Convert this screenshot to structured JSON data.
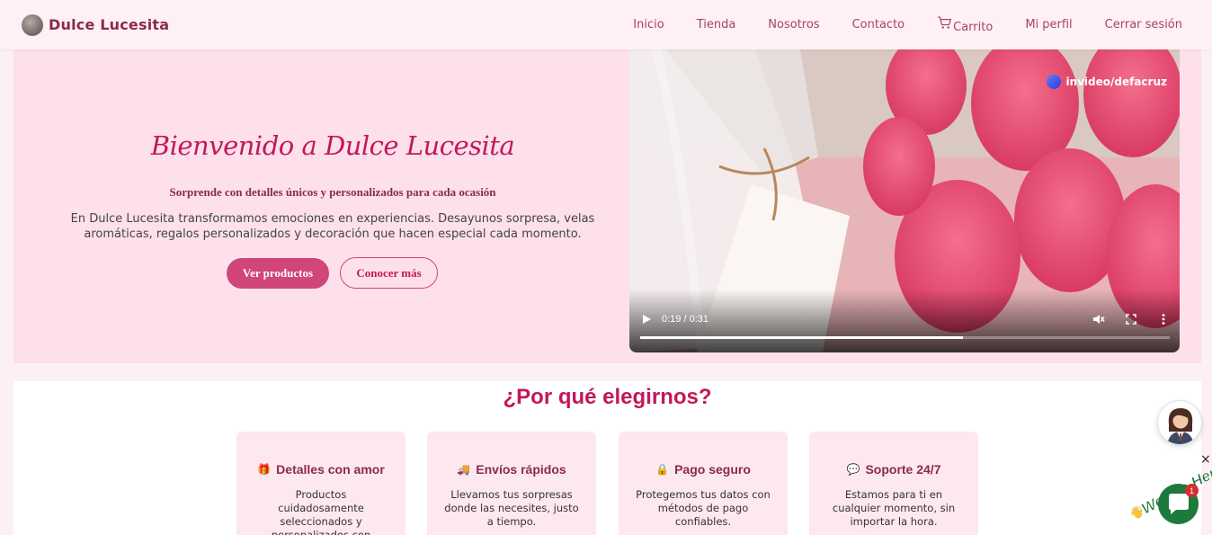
{
  "nav": {
    "brand": "Dulce Lucesita",
    "links": [
      "Inicio",
      "Tienda",
      "Nosotros",
      "Contacto",
      "Carrito",
      "Mi perfil",
      "Cerrar sesión"
    ]
  },
  "hero": {
    "title": "Bienvenido a Dulce Lucesita",
    "subtitle": "Sorprende con detalles únicos y personalizados para cada ocasión",
    "description": "En Dulce Lucesita transformamos emociones en experiencias. Desayunos sorpresa, velas aromáticas, regalos personalizados y decoración que hacen especial cada momento.",
    "btn_primary": "Ver productos",
    "btn_secondary": "Conocer más"
  },
  "video": {
    "watermark": "invideo/defacruz",
    "time": "0:19 / 0:31",
    "progress": 0.61
  },
  "why": {
    "title": "¿Por qué elegirnos?",
    "cards": [
      {
        "emoji": "🎁",
        "title": "Detalles con amor",
        "text": "Productos cuidadosamente seleccionados y personalizados con elegancia."
      },
      {
        "emoji": "🚚",
        "title": "Envíos rápidos",
        "text": "Llevamos tus sorpresas donde las necesites, justo a tiempo."
      },
      {
        "emoji": "🔒",
        "title": "Pago seguro",
        "text": "Protegemos tus datos con métodos de pago confiables."
      },
      {
        "emoji": "💬",
        "title": "Soporte 24/7",
        "text": "Estamos para ti en cualquier momento, sin importar la hora."
      }
    ]
  },
  "chat": {
    "tag": "We Are Here!",
    "badge": "1",
    "close": "×"
  },
  "colors": {
    "brand": "#8a2a4f",
    "accent": "#d0457a",
    "hero_bg": "#fde0ea"
  }
}
